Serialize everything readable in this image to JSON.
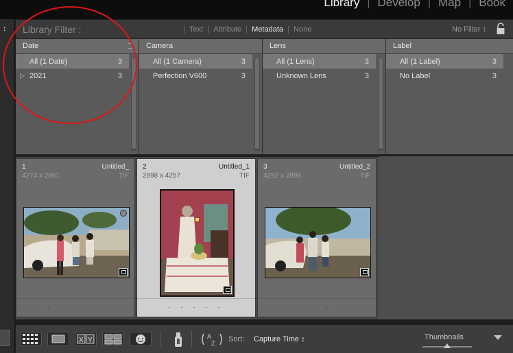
{
  "modules": [
    "Library",
    "Develop",
    "Map",
    "Book"
  ],
  "active_module": "Library",
  "filter_bar": {
    "title": "Library Filter :",
    "tabs": [
      "Text",
      "Attribute",
      "Metadata",
      "None"
    ],
    "active_tab": "Metadata",
    "preset": "No Filter ↕"
  },
  "columns": [
    {
      "header": "Date",
      "rows": [
        {
          "label": "All (1 Date)",
          "count": "3",
          "selected": true
        },
        {
          "label": "2021",
          "count": "3",
          "selected": false,
          "disclosure": "▷"
        }
      ]
    },
    {
      "header": "Camera",
      "rows": [
        {
          "label": "All (1 Camera)",
          "count": "3",
          "selected": true
        },
        {
          "label": "Perfection V600",
          "count": "3",
          "selected": false
        }
      ]
    },
    {
      "header": "Lens",
      "rows": [
        {
          "label": "All (1 Lens)",
          "count": "3",
          "selected": true
        },
        {
          "label": "Unknown Lens",
          "count": "3",
          "selected": false
        }
      ]
    },
    {
      "header": "Label",
      "rows": [
        {
          "label": "All (1 Label)",
          "count": "3",
          "selected": true
        },
        {
          "label": "No Label",
          "count": "3",
          "selected": false
        }
      ]
    }
  ],
  "photos": [
    {
      "number": "1",
      "name": "Untitled_",
      "dims": "4274 x 2861",
      "ext": "TIF",
      "selected": false,
      "orientation": "landscape"
    },
    {
      "number": "2",
      "name": "Untitled_1",
      "dims": "2898 x 4257",
      "ext": "TIF",
      "selected": true,
      "orientation": "portrait"
    },
    {
      "number": "3",
      "name": "Untitled_2",
      "dims": "4292 x 2898",
      "ext": "TIF",
      "selected": false,
      "orientation": "landscape"
    }
  ],
  "cell_dots": "· · · · ·",
  "toolbar": {
    "sort_label": "Sort:",
    "sort_value": "Capture Time ↕",
    "thumbnails_label": "Thumbnails",
    "view_buttons": [
      "grid-view-icon",
      "loupe-view-icon",
      "compare-view-icon",
      "survey-view-icon",
      "people-view-icon"
    ],
    "compare_label": "X|Y"
  },
  "colors": {
    "accent_annotation": "#e01616",
    "panel": "#5a5a5a",
    "selected_cell": "#cfcfcf"
  }
}
